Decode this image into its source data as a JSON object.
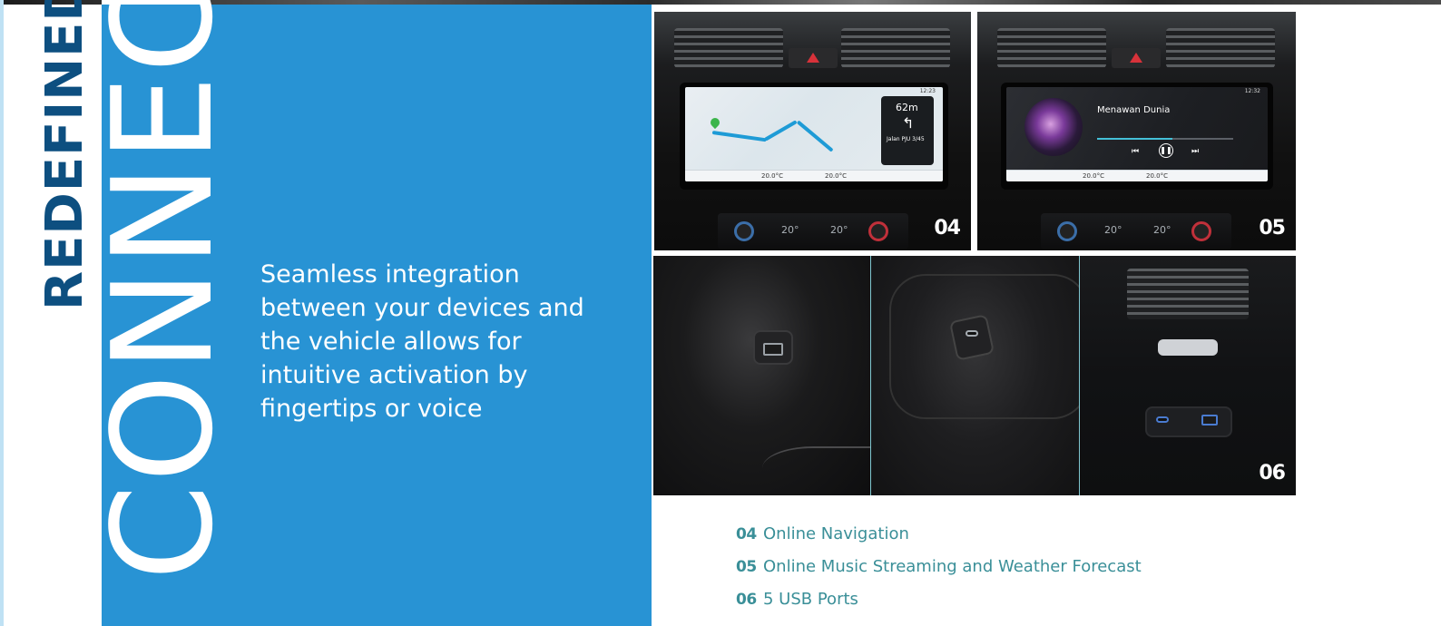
{
  "heading": {
    "word_small": "REDEFINED",
    "word_large": "CONNECT"
  },
  "tagline": "Seamless integration between your devices and the vehicle allows for intuitive activation by fingertips or voice",
  "photos": {
    "nav": {
      "number": "04",
      "clock": "12:23",
      "distance": "62m",
      "street": "Jalan PJU 3/45",
      "temp_left": "20.0°C",
      "temp_right": "20.0°C",
      "climate_left": "20°",
      "climate_right": "20°"
    },
    "music": {
      "number": "05",
      "clock": "12:32",
      "song_title": "Menawan Dunia",
      "progress": 0.55,
      "temp_left": "20.0°C",
      "temp_right": "20.0°C",
      "climate_left": "20°",
      "climate_right": "20°"
    },
    "usb": {
      "number": "06"
    }
  },
  "captions": [
    {
      "number": "04",
      "text": "Online Navigation"
    },
    {
      "number": "05",
      "text": "Online Music Streaming and Weather Forecast"
    },
    {
      "number": "06",
      "text": "5 USB Ports"
    }
  ],
  "colors": {
    "panel_blue": "#2893d4",
    "heading_dark_blue": "#0d4f80",
    "caption_teal": "#3a8f98"
  }
}
